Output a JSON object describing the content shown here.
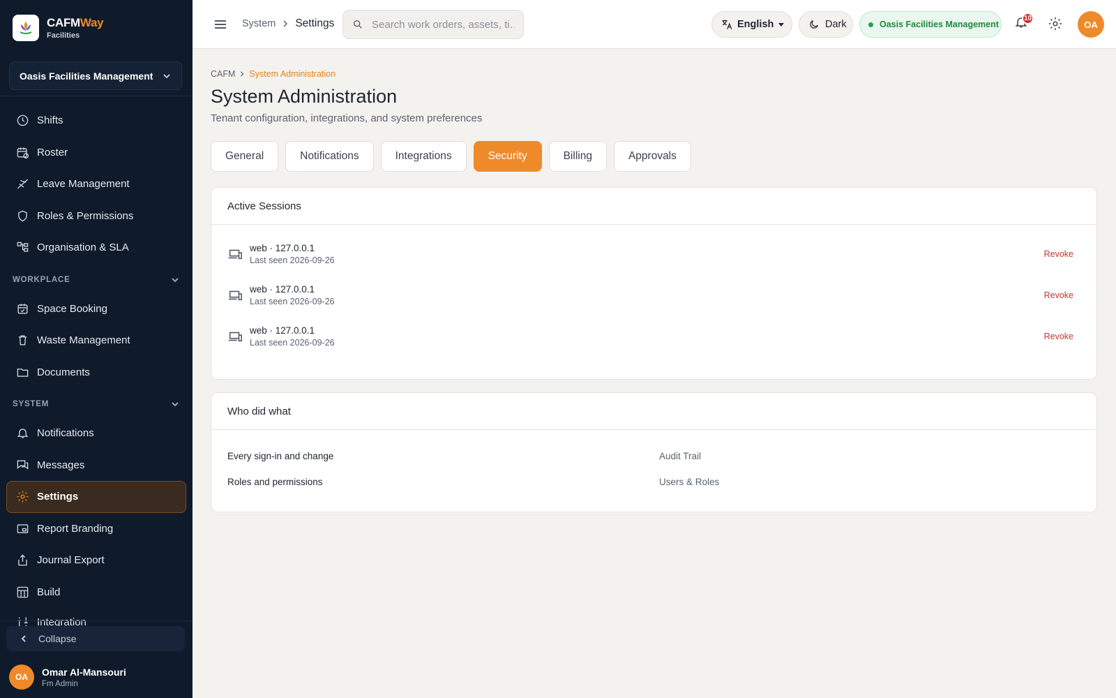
{
  "brand": {
    "name_main": "CAFM",
    "name_accent": "Way",
    "subtitle": "Facilities"
  },
  "org_selector": {
    "value": "Oasis Facilities Management"
  },
  "sidebar": {
    "items_top": [
      {
        "label": "Shifts",
        "icon": "clock-icon"
      },
      {
        "label": "Roster",
        "icon": "calendar-clock-icon"
      },
      {
        "label": "Leave Management",
        "icon": "plane-icon"
      },
      {
        "label": "Roles & Permissions",
        "icon": "shield-icon"
      },
      {
        "label": "Organisation & SLA",
        "icon": "org-chart-icon"
      }
    ],
    "section_workplace": "WORKPLACE",
    "items_workplace": [
      {
        "label": "Space Booking",
        "icon": "calendar-check-icon"
      },
      {
        "label": "Waste Management",
        "icon": "trash-icon"
      },
      {
        "label": "Documents",
        "icon": "folder-icon"
      }
    ],
    "section_system": "SYSTEM",
    "items_system": [
      {
        "label": "Notifications",
        "icon": "bell-icon"
      },
      {
        "label": "Messages",
        "icon": "chat-icon"
      },
      {
        "label": "Settings",
        "icon": "gear-icon",
        "active": true
      },
      {
        "label": "Report Branding",
        "icon": "image-frame-icon"
      },
      {
        "label": "Journal Export",
        "icon": "export-icon"
      },
      {
        "label": "Build",
        "icon": "grid-icon"
      },
      {
        "label": "Integration",
        "icon": "integration-icon"
      }
    ],
    "collapse_label": "Collapse"
  },
  "user": {
    "initials": "OA",
    "name": "Omar Al-Mansouri",
    "role": "Fm Admin"
  },
  "topbar": {
    "crumb_parent": "System",
    "crumb_current": "Settings",
    "search_placeholder": "Search work orders, assets, ti…",
    "language": "English",
    "theme_label": "Dark",
    "tenant": "Oasis Facilities Management",
    "notification_count": "10",
    "avatar_initials": "OA"
  },
  "page": {
    "breadcrumb_root": "CAFM",
    "breadcrumb_current": "System Administration",
    "title": "System Administration",
    "subtitle": "Tenant configuration, integrations, and system preferences",
    "tabs": [
      "General",
      "Notifications",
      "Integrations",
      "Security",
      "Billing",
      "Approvals"
    ],
    "active_tab": "Security"
  },
  "sessions": {
    "title": "Active Sessions",
    "items": [
      {
        "title": "web · 127.0.0.1",
        "last_seen": "Last seen 2026-09-26",
        "action": "Revoke"
      },
      {
        "title": "web · 127.0.0.1",
        "last_seen": "Last seen 2026-09-26",
        "action": "Revoke"
      },
      {
        "title": "web · 127.0.0.1",
        "last_seen": "Last seen 2026-09-26",
        "action": "Revoke"
      }
    ]
  },
  "audit": {
    "title": "Who did what",
    "rows": [
      {
        "label": "Every sign-in and change",
        "link": "Audit Trail"
      },
      {
        "label": "Roles and permissions",
        "link": "Users & Roles"
      }
    ]
  },
  "colors": {
    "accent": "#ef8a2a",
    "sidebar_bg": "#0f1a2a",
    "revoke": "#c0392b",
    "tenant_green": "#1c8a3e"
  }
}
